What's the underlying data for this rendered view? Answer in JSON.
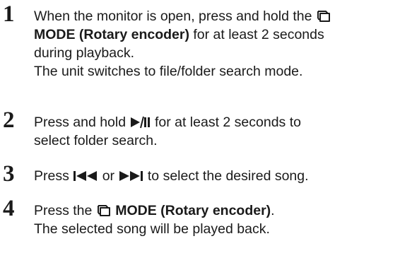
{
  "steps": [
    {
      "number": "1",
      "line1_text": "When the monitor is open, press and hold the",
      "line2_bold": "MODE (Rotary encoder)",
      "line2_text": "for at least 2 seconds",
      "line3_text": "during playback.",
      "line4_text": "The unit switches to file/folder search mode."
    },
    {
      "number": "2",
      "line1_pre": "Press and hold",
      "line1_post": "for at least 2 seconds to",
      "line2_text": "select folder search."
    },
    {
      "number": "3",
      "line1_pre": "Press",
      "line1_mid": "or",
      "line1_post": "to select the desired song."
    },
    {
      "number": "4",
      "line1_pre": "Press the",
      "line1_bold": "MODE (Rotary encoder)",
      "line1_post": ".",
      "line2_text": "The selected song will be played back."
    }
  ],
  "icons": [
    "mode-icon",
    "play-pause-icon",
    "previous-icon",
    "next-icon"
  ]
}
